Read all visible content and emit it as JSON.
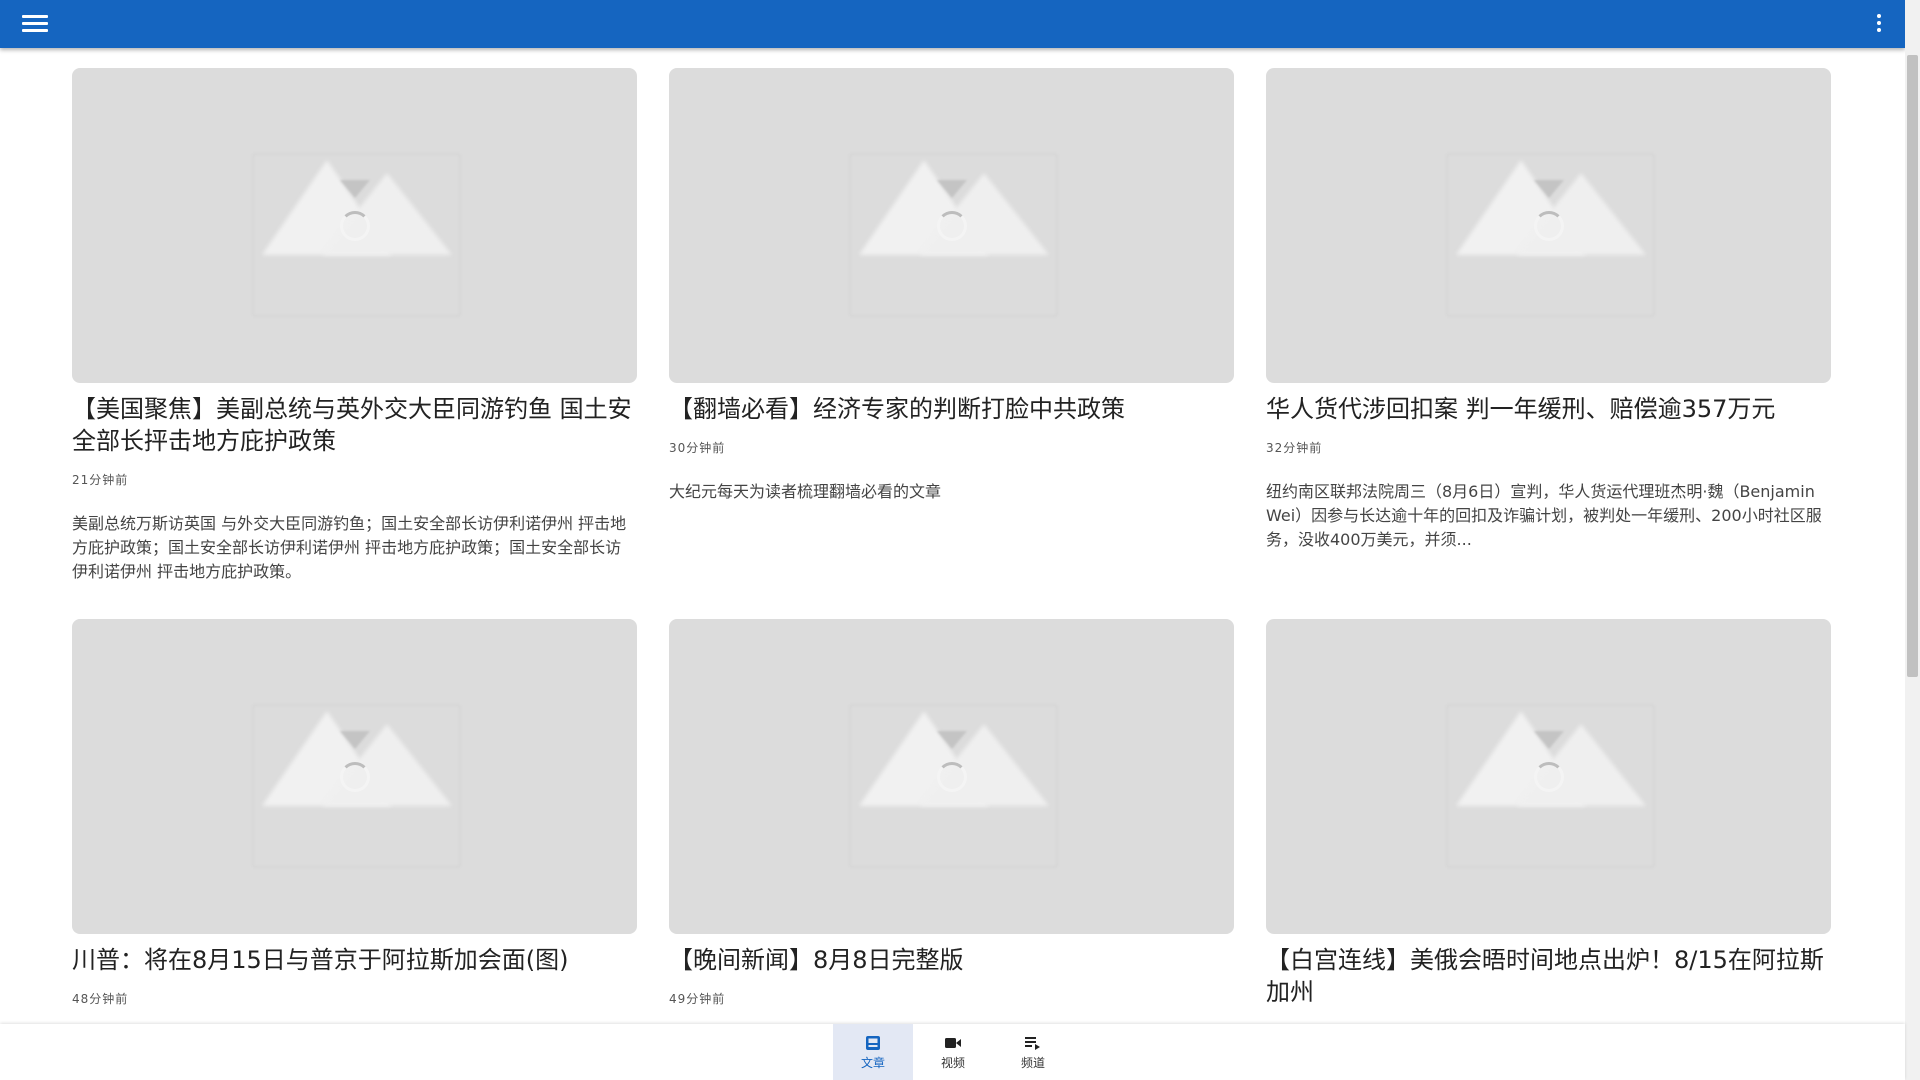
{
  "appbar": {
    "menu_icon": "hamburger-menu-icon",
    "more_icon": "more-vert-icon",
    "background": "#1565c0"
  },
  "articles": [
    {
      "title": "【美国聚焦】美副总统与英外交大臣同游钓鱼 国土安全部长抨击地方庇护政策",
      "time": "21分钟前",
      "summary": "美副总统万斯访英国 与外交大臣同游钓鱼；国土安全部长访伊利诺伊州 抨击地方庇护政策；国土安全部长访伊利诺伊州 抨击地方庇护政策；国土安全部长访伊利诺伊州 抨击地方庇护政策。"
    },
    {
      "title": "【翻墙必看】经济专家的判断打脸中共政策",
      "time": "30分钟前",
      "summary": "大纪元每天为读者梳理翻墙必看的文章"
    },
    {
      "title": "华人货代涉回扣案 判一年缓刑、赔偿逾357万元",
      "time": "32分钟前",
      "summary": "纽约南区联邦法院周三（8月6日）宣判，华人货运代理班杰明·魏（Benjamin Wei）因参与长达逾十年的回扣及诈骗计划，被判处一年缓刑、200小时社区服务，没收400万美元，并须..."
    },
    {
      "title": "川普：将在8月15日与普京于阿拉斯加会面(图)",
      "time": "48分钟前",
      "summary": ""
    },
    {
      "title": "【晚间新闻】8月8日完整版",
      "time": "49分钟前",
      "summary": ""
    },
    {
      "title": "【白宫连线】美俄会晤时间地点出炉！8/15在阿拉斯加州",
      "time": "",
      "summary": ""
    }
  ],
  "bottom_nav": {
    "items": [
      {
        "label": "文章",
        "icon": "article-icon",
        "active": true
      },
      {
        "label": "视频",
        "icon": "videocam-icon",
        "active": false
      },
      {
        "label": "频道",
        "icon": "playlist-icon",
        "active": false
      }
    ],
    "active_color": "#1565c0"
  }
}
